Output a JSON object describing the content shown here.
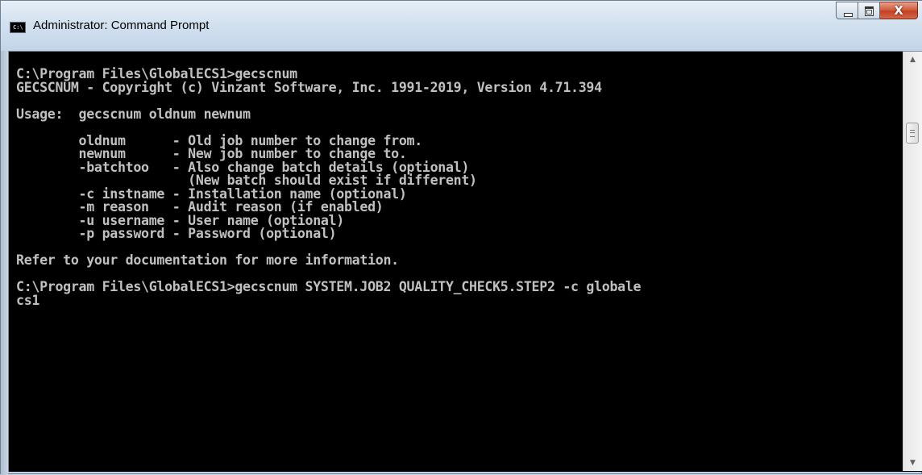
{
  "window": {
    "title": "Administrator: Command Prompt",
    "icon_label": "C:\\",
    "icon": "console-icon"
  },
  "caption_buttons": {
    "minimize_icon": "minimize-icon",
    "maximize_icon": "maximize-icon",
    "close_icon": "close-icon",
    "close_glyph": "X"
  },
  "console": {
    "background": "#000000",
    "foreground": "#c0c0c0",
    "lines": [
      "C:\\Program Files\\GlobalECS1>gecscnum",
      "GECSCNUM - Copyright (c) Vinzant Software, Inc. 1991-2019, Version 4.71.394",
      "",
      "Usage:  gecscnum oldnum newnum",
      "",
      "        oldnum      - Old job number to change from.",
      "        newnum      - New job number to change to.",
      "        -batchtoo   - Also change batch details (optional)",
      "                      (New batch should exist if different)",
      "        -c instname - Installation name (optional)",
      "        -m reason   - Audit reason (if enabled)",
      "        -u username - User name (optional)",
      "        -p password - Password (optional)",
      "",
      "Refer to your documentation for more information.",
      "",
      "C:\\Program Files\\GlobalECS1>gecscnum SYSTEM.JOB2 QUALITY_CHECK5.STEP2 -c globale",
      "cs1"
    ]
  },
  "scrollbar": {
    "up_arrow": "▲",
    "down_arrow": "▼",
    "thumb_position_fraction": 0.15
  }
}
